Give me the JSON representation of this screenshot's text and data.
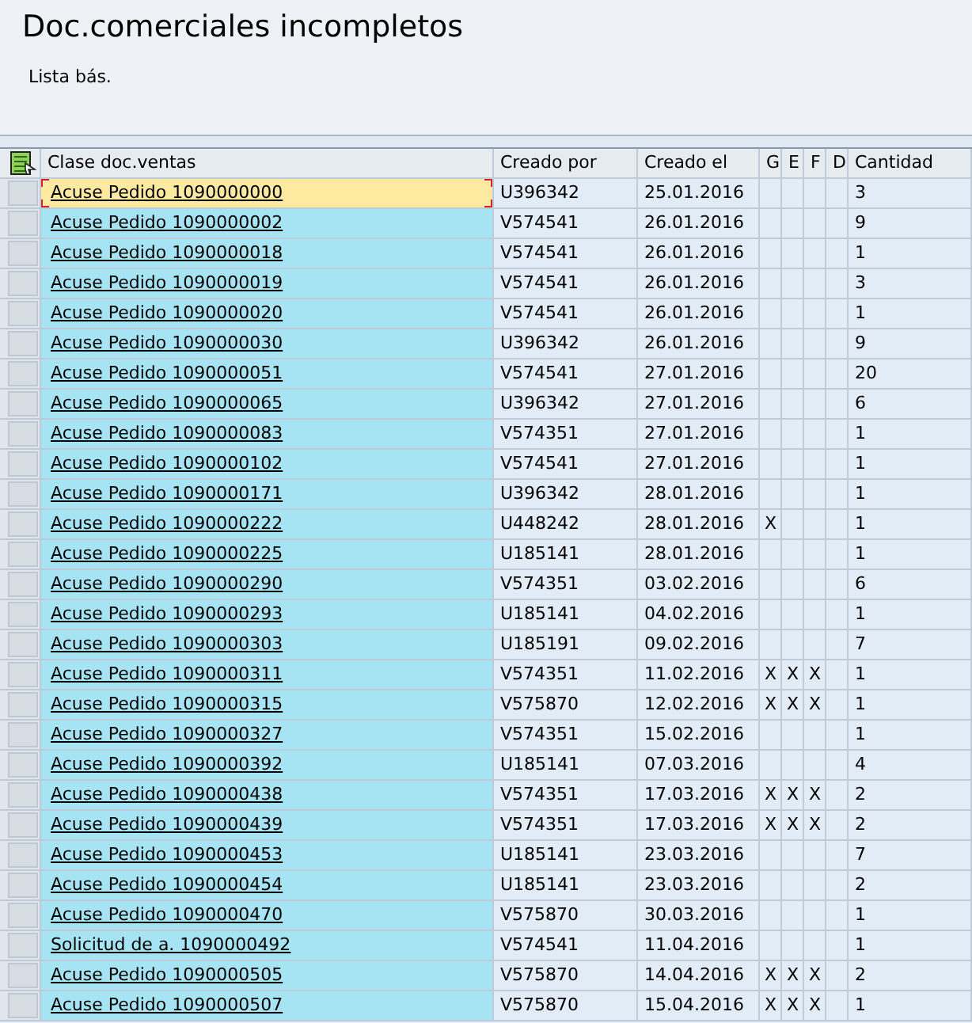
{
  "title": "Doc.comerciales incompletos",
  "subtitle": "Lista bás.",
  "table": {
    "columns": [
      "Clase doc.ventas",
      "Creado por",
      "Creado el",
      "G",
      "E",
      "F",
      "D",
      "Cantidad"
    ],
    "rows": [
      {
        "doc": "Acuse Pedido 1090000000",
        "by": "U396342",
        "date": "25.01.2016",
        "qty": "3",
        "selected": true
      },
      {
        "doc": "Acuse Pedido 1090000002",
        "by": "V574541",
        "date": "26.01.2016",
        "qty": "9",
        "selected": false
      },
      {
        "doc": "Acuse Pedido 1090000018",
        "by": "V574541",
        "date": "26.01.2016",
        "qty": "1",
        "selected": false
      },
      {
        "doc": "Acuse Pedido 1090000019",
        "by": "V574541",
        "date": "26.01.2016",
        "qty": "3",
        "selected": false
      },
      {
        "doc": "Acuse Pedido 1090000020",
        "by": "V574541",
        "date": "26.01.2016",
        "qty": "1",
        "selected": false
      },
      {
        "doc": "Acuse Pedido 1090000030",
        "by": "U396342",
        "date": "26.01.2016",
        "qty": "9",
        "selected": false
      },
      {
        "doc": "Acuse Pedido 1090000051",
        "by": "V574541",
        "date": "27.01.2016",
        "qty": "20",
        "selected": false
      },
      {
        "doc": "Acuse Pedido 1090000065",
        "by": "U396342",
        "date": "27.01.2016",
        "qty": "6",
        "selected": false
      },
      {
        "doc": "Acuse Pedido 1090000083",
        "by": "V574351",
        "date": "27.01.2016",
        "qty": "1",
        "selected": false
      },
      {
        "doc": "Acuse Pedido 1090000102",
        "by": "V574541",
        "date": "27.01.2016",
        "qty": "1",
        "selected": false
      },
      {
        "doc": "Acuse Pedido 1090000171",
        "by": "U396342",
        "date": "28.01.2016",
        "qty": "1",
        "selected": false
      },
      {
        "doc": "Acuse Pedido 1090000222",
        "by": "U448242",
        "date": "28.01.2016",
        "g": "X",
        "qty": "1",
        "selected": false
      },
      {
        "doc": "Acuse Pedido 1090000225",
        "by": "U185141",
        "date": "28.01.2016",
        "qty": "1",
        "selected": false
      },
      {
        "doc": "Acuse Pedido 1090000290",
        "by": "V574351",
        "date": "03.02.2016",
        "qty": "6",
        "selected": false
      },
      {
        "doc": "Acuse Pedido 1090000293",
        "by": "U185141",
        "date": "04.02.2016",
        "qty": "1",
        "selected": false
      },
      {
        "doc": "Acuse Pedido 1090000303",
        "by": "U185191",
        "date": "09.02.2016",
        "qty": "7",
        "selected": false
      },
      {
        "doc": "Acuse Pedido 1090000311",
        "by": "V574351",
        "date": "11.02.2016",
        "g": "X",
        "e": "X",
        "f": "X",
        "qty": "1",
        "selected": false
      },
      {
        "doc": "Acuse Pedido 1090000315",
        "by": "V575870",
        "date": "12.02.2016",
        "g": "X",
        "e": "X",
        "f": "X",
        "qty": "1",
        "selected": false
      },
      {
        "doc": "Acuse Pedido 1090000327",
        "by": "V574351",
        "date": "15.02.2016",
        "qty": "1",
        "selected": false
      },
      {
        "doc": "Acuse Pedido 1090000392",
        "by": "U185141",
        "date": "07.03.2016",
        "qty": "4",
        "selected": false
      },
      {
        "doc": "Acuse Pedido 1090000438",
        "by": "V574351",
        "date": "17.03.2016",
        "g": "X",
        "e": "X",
        "f": "X",
        "qty": "2",
        "selected": false
      },
      {
        "doc": "Acuse Pedido 1090000439",
        "by": "V574351",
        "date": "17.03.2016",
        "g": "X",
        "e": "X",
        "f": "X",
        "qty": "2",
        "selected": false
      },
      {
        "doc": "Acuse Pedido 1090000453",
        "by": "U185141",
        "date": "23.03.2016",
        "qty": "7",
        "selected": false
      },
      {
        "doc": "Acuse Pedido 1090000454",
        "by": "U185141",
        "date": "23.03.2016",
        "qty": "2",
        "selected": false
      },
      {
        "doc": "Acuse Pedido 1090000470",
        "by": "V575870",
        "date": "30.03.2016",
        "qty": "1",
        "selected": false
      },
      {
        "doc": "Solicitud de a. 1090000492",
        "by": "V574541",
        "date": "11.04.2016",
        "qty": "1",
        "selected": false
      },
      {
        "doc": "Acuse Pedido 1090000505",
        "by": "V575870",
        "date": "14.04.2016",
        "g": "X",
        "e": "X",
        "f": "X",
        "qty": "2",
        "selected": false
      },
      {
        "doc": "Acuse Pedido 1090000507",
        "by": "V575870",
        "date": "15.04.2016",
        "g": "X",
        "e": "X",
        "f": "X",
        "qty": "1",
        "selected": false
      }
    ]
  }
}
